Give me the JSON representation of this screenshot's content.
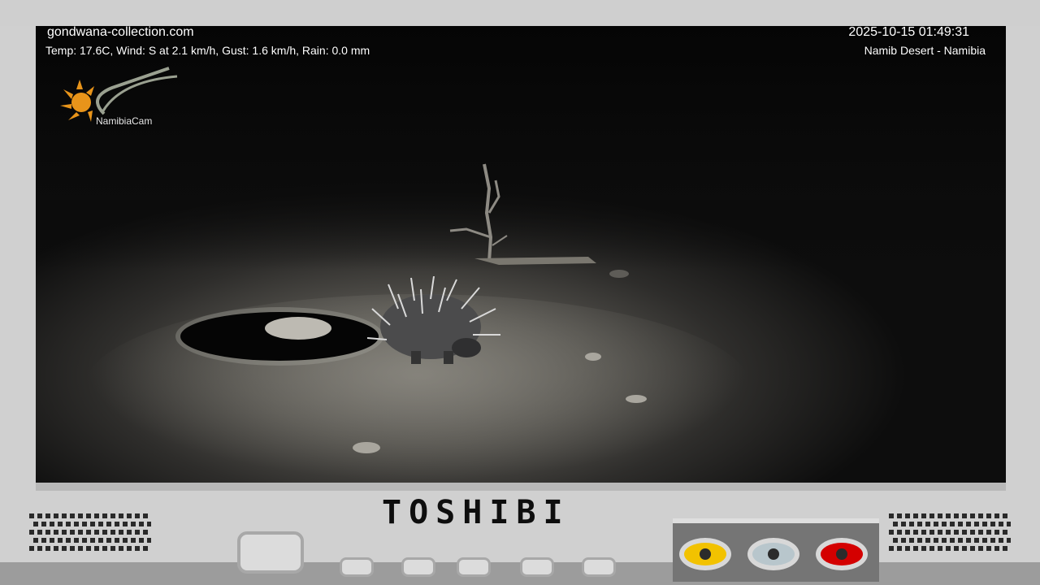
{
  "camera": {
    "site": "gondwana-collection.com",
    "weather": "Temp: 17.6C, Wind: S at 2.1 km/h, Gust: 1.6 km/h, Rain: 0.0 mm",
    "timestamp": "2025-10-15 01:49:31",
    "location": "Namib Desert - Namibia",
    "logo_text": "NamibiaCam"
  },
  "tv": {
    "brand": "TOSHIBI",
    "jacks": [
      {
        "name": "yellow-jack",
        "color": "#f2c200"
      },
      {
        "name": "white-jack",
        "color": "#b8c6cc"
      },
      {
        "name": "red-jack",
        "color": "#d40000"
      }
    ]
  }
}
